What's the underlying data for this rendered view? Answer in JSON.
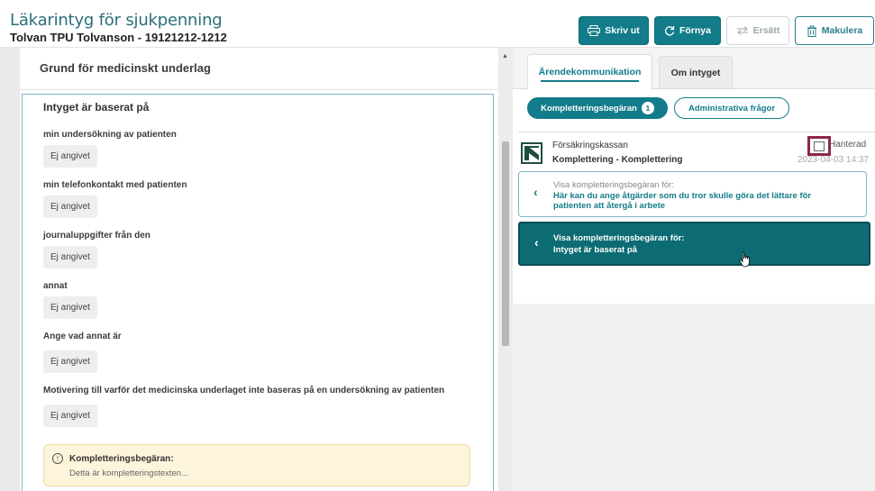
{
  "header": {
    "title": "Läkarintyg för sjukpenning",
    "patient": "Tolvan TPU Tolvanson - 19121212-1212",
    "buttons": {
      "print": "Skriv ut",
      "renew": "Förnya",
      "replace": "Ersätt",
      "cancel": "Makulera"
    }
  },
  "left": {
    "section_title": "Grund för medicinskt underlag",
    "card_title": "Intyget är baserat på",
    "fields": [
      {
        "label": "min undersökning av patienten",
        "value": "Ej angivet"
      },
      {
        "label": "min telefonkontakt med patienten",
        "value": "Ej angivet"
      },
      {
        "label": "journaluppgifter från den",
        "value": "Ej angivet"
      },
      {
        "label": "annat",
        "value": "Ej angivet"
      },
      {
        "label": "Ange vad annat är",
        "value": "Ej angivet"
      },
      {
        "label": "Motivering till varför det medicinska underlaget inte baseras på en undersökning av patienten",
        "value": "Ej angivet"
      }
    ],
    "komplettering": {
      "title": "Kompletteringsbegäran:",
      "text": "Detta är kompletteringstexten..."
    }
  },
  "right": {
    "tabs": [
      "Ärendekommunikation",
      "Om intyget"
    ],
    "filters": {
      "komplettering_label": "Kompletteringsbegäran",
      "komplettering_count": "1",
      "admin_label": "Administrativa frågor"
    },
    "message": {
      "sender": "Försäkringskassan",
      "subject": "Komplettering - Komplettering",
      "handled_label": "Hanterad",
      "date": "2023-04-03 14:37"
    },
    "requests": [
      {
        "prefix": "Visa kompletteringsbegäran för:",
        "text": "Här kan du ange åtgärder som du tror skulle göra det lättare för patienten att återgå i arbete"
      },
      {
        "prefix": "Visa kompletteringsbegäran för:",
        "text": "Intyget är baserat på"
      }
    ]
  },
  "colors": {
    "primary": "#137c8a",
    "dark_teal": "#0d6b73",
    "highlight_border": "#8c2749",
    "notice_bg": "#fdf4dc"
  }
}
